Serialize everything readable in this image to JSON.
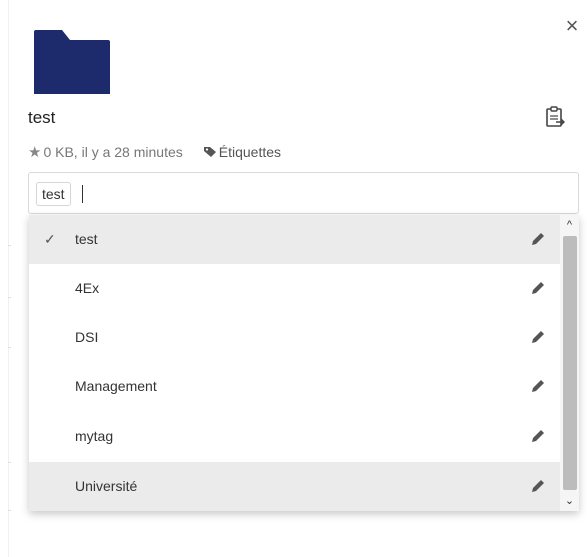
{
  "dialog": {
    "close_symbol": "×",
    "folder_icon": "folder-icon",
    "folder_color": "#1d2a6b",
    "file_name": "test",
    "clipboard_icon": "clipboard-icon",
    "meta": {
      "star_icon": "star-icon",
      "star_symbol": "★",
      "info": "0 KB, il y a 28 minutes",
      "tag_icon": "tag-icon",
      "tags_label": "Étiquettes"
    }
  },
  "tag_input": {
    "selected_tag": "test",
    "value": ""
  },
  "dropdown": {
    "options": [
      {
        "label": "test",
        "checked": true,
        "highlighted": true
      },
      {
        "label": "4Ex",
        "checked": false,
        "highlighted": false
      },
      {
        "label": "DSI",
        "checked": false,
        "highlighted": false
      },
      {
        "label": "Management",
        "checked": false,
        "highlighted": false
      },
      {
        "label": "mytag",
        "checked": false,
        "highlighted": false
      },
      {
        "label": "Université",
        "checked": false,
        "highlighted": true
      }
    ],
    "check_symbol": "✓",
    "edit_icon": "pencil-icon",
    "scroll_up_symbol": "^",
    "scroll_down_symbol": "⌄"
  }
}
